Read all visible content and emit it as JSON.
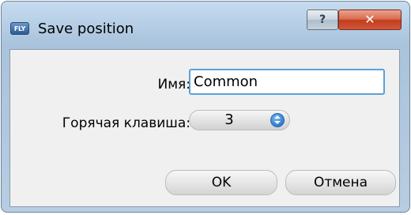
{
  "window": {
    "title": "Save position",
    "app_icon_text": "FLY",
    "help_label": "?",
    "close_label": "✕"
  },
  "form": {
    "name_label": "Имя:",
    "name_value": "Common",
    "hotkey_label": "Горячая клавиша:",
    "hotkey_value": "3"
  },
  "buttons": {
    "ok_label": "OK",
    "cancel_label": "Отмена"
  },
  "icons": {
    "app": "app-logo-icon",
    "help": "question-icon",
    "close": "close-icon",
    "spinner": "spin-arrows-icon"
  },
  "colors": {
    "title_bar": "#b9d1e8",
    "close_button": "#c03c1c",
    "input_focus_border": "#5da0d8",
    "spinner_accent": "#2f7bd0",
    "client_background": "#f0f0f0"
  }
}
